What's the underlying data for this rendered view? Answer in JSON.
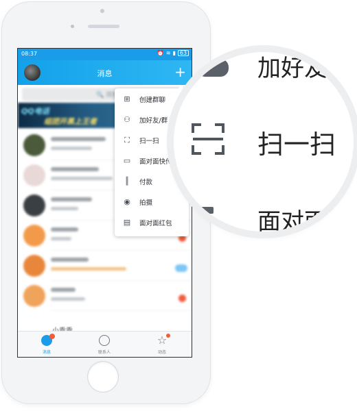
{
  "status_bar": {
    "time": "08:37",
    "battery": "63"
  },
  "header": {
    "title": "消息"
  },
  "search": {
    "placeholder": "搜索"
  },
  "banner": {
    "title": "QQ电话",
    "subtitle": "组团开黑上王者"
  },
  "dropdown_menu": {
    "items": [
      {
        "label": "创建群聊",
        "icon": "create-group-chat-icon"
      },
      {
        "label": "加好友/群",
        "icon": "add-friend-icon"
      },
      {
        "label": "扫一扫",
        "icon": "scan-icon"
      },
      {
        "label": "面对面快传",
        "icon": "face-to-face-transfer-icon"
      },
      {
        "label": "付款",
        "icon": "barcode-payment-icon"
      },
      {
        "label": "拍摄",
        "icon": "camera-icon"
      },
      {
        "label": "面对面红包",
        "icon": "face-to-face-red-packet-icon"
      }
    ]
  },
  "conversation_list": {
    "last_visible_item": "小乖乖"
  },
  "tab_bar": {
    "tabs": [
      {
        "label": "消息",
        "icon": "message-icon",
        "active": true
      },
      {
        "label": "联系人",
        "icon": "contacts-icon",
        "active": false
      },
      {
        "label": "动态",
        "icon": "star-icon",
        "active": false
      }
    ]
  },
  "magnifier": {
    "top_text": "加好友",
    "middle_text": "扫一扫",
    "bottom_text": "面对面"
  },
  "colors": {
    "accent": "#1a9ce8",
    "badge": "#f05d3c"
  }
}
